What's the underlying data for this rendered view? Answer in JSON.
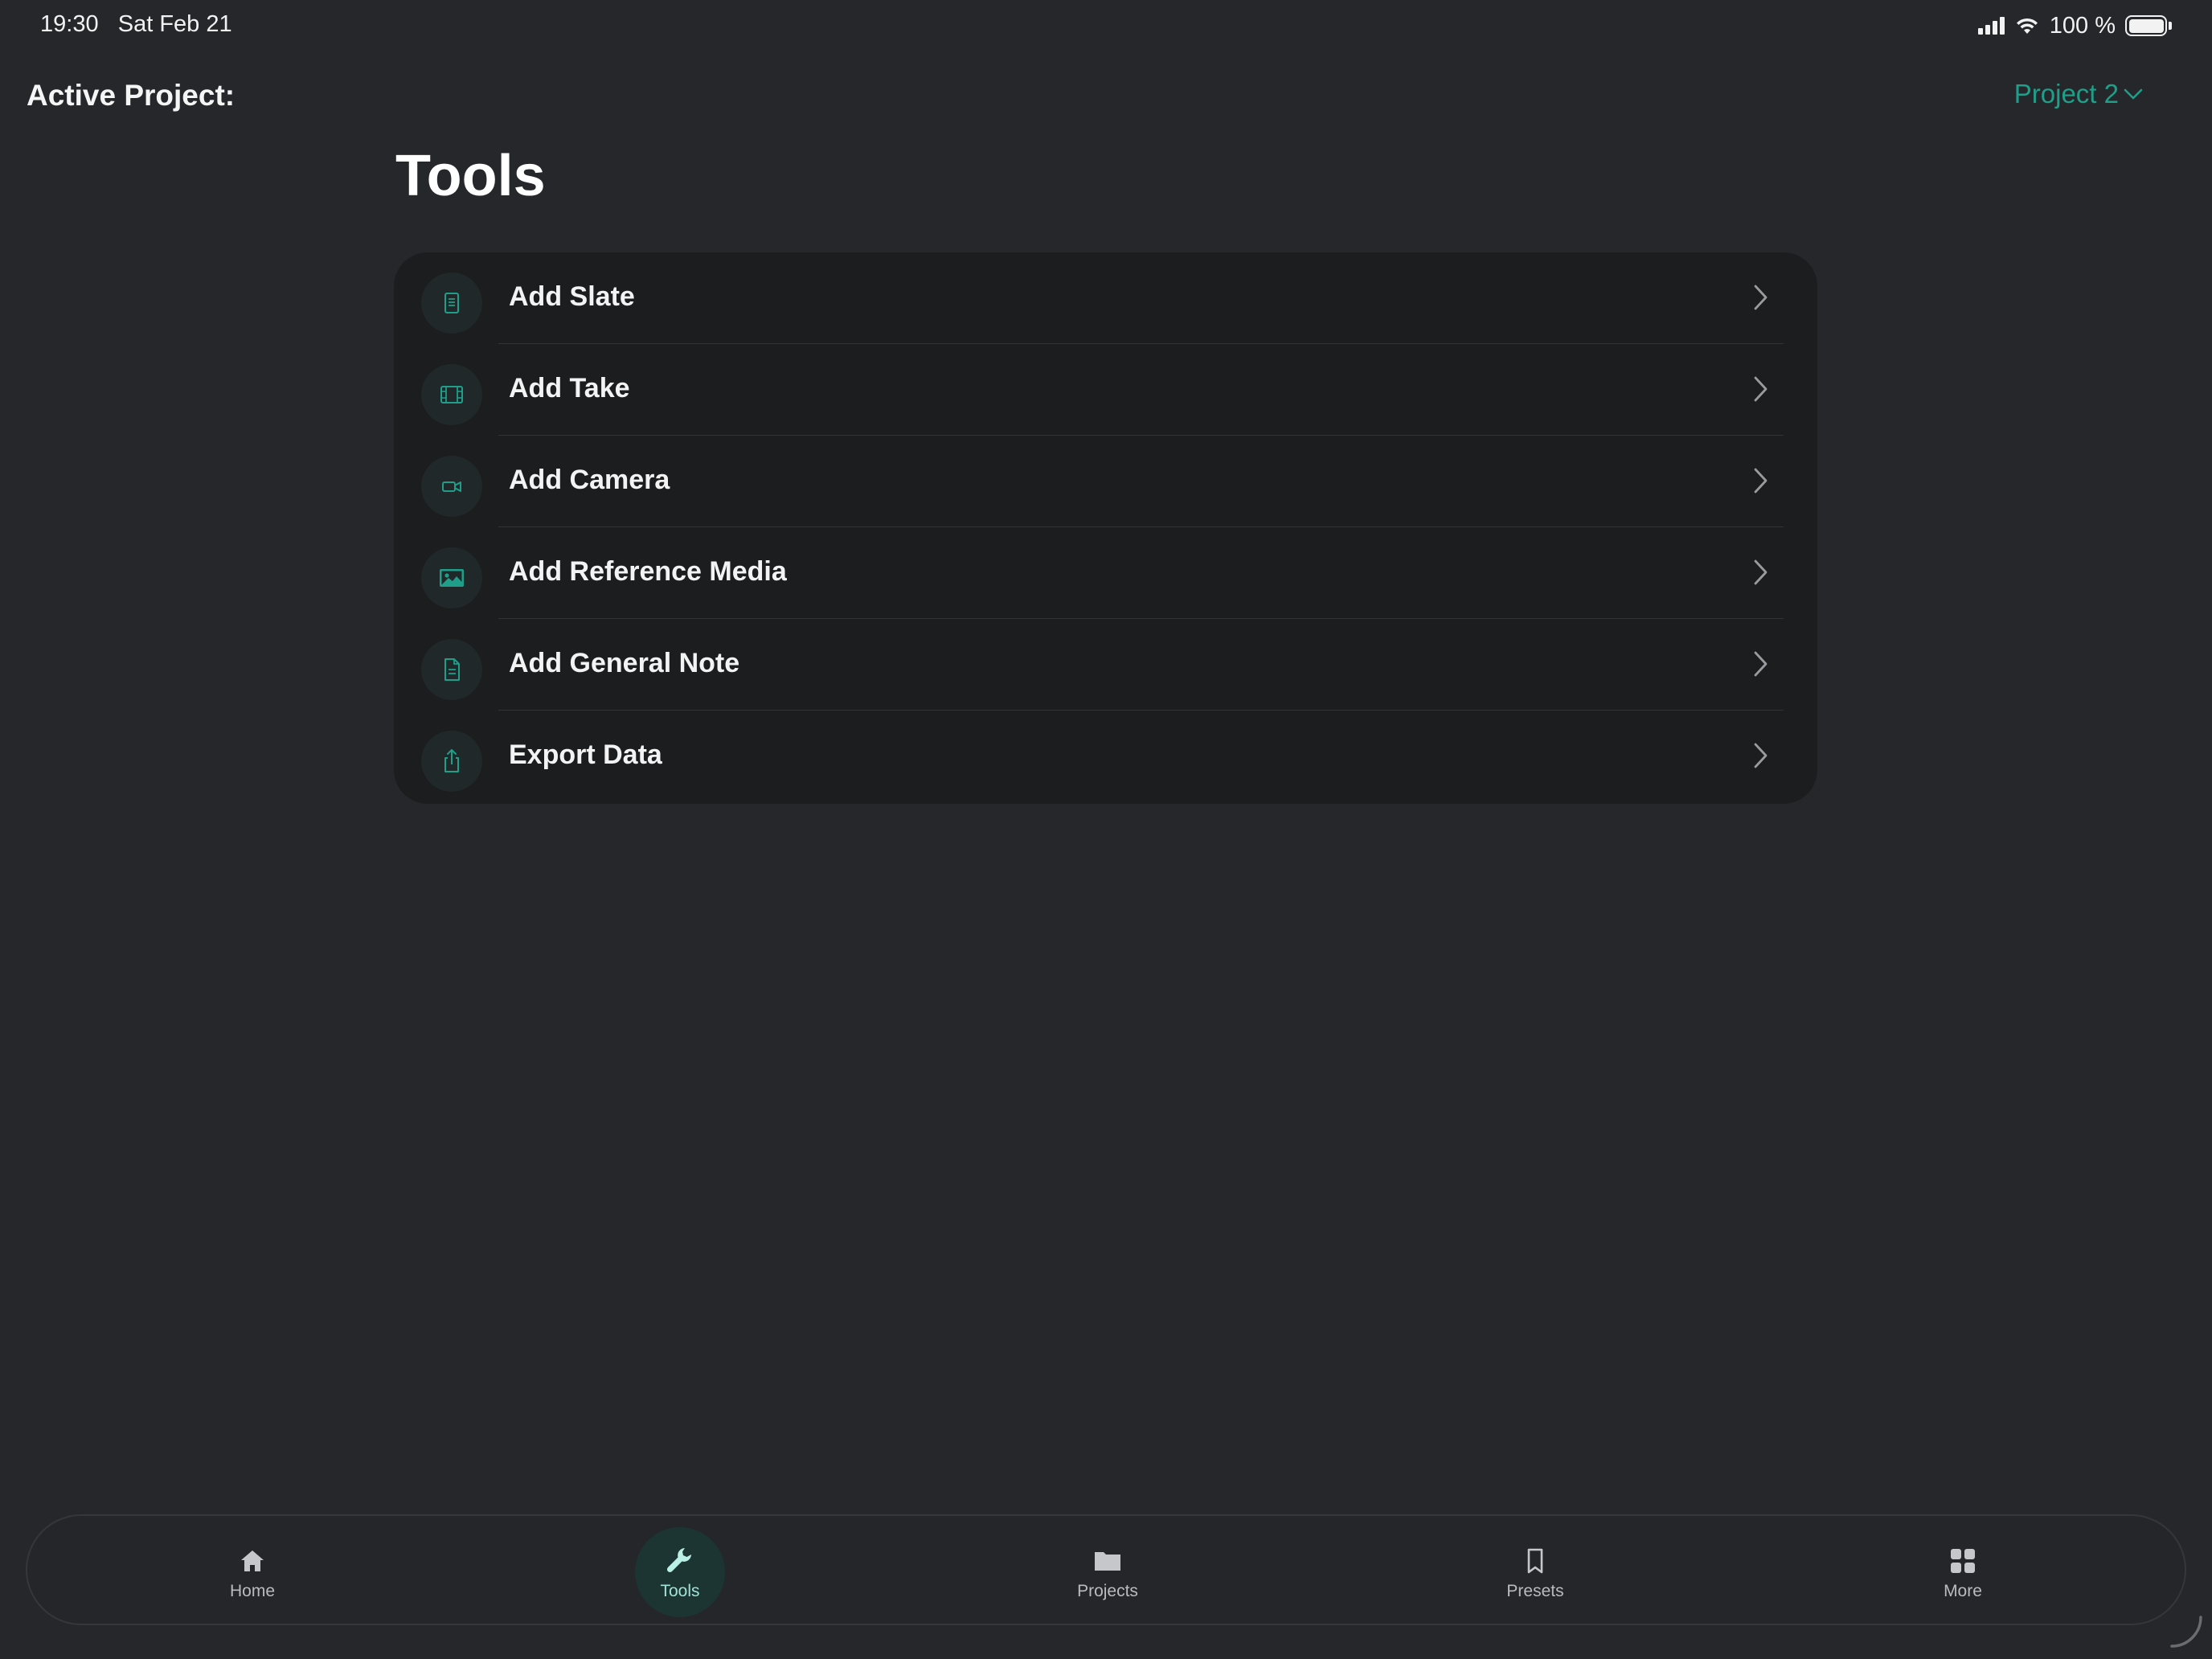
{
  "status_bar": {
    "time_date": "19:30   Sat Feb 21",
    "battery_text": "100 %"
  },
  "header": {
    "active_project_label": "Active Project:",
    "project_selector_value": "Project 2"
  },
  "page": {
    "title": "Tools"
  },
  "tools": [
    {
      "label": "Add Slate",
      "icon": "slate-icon"
    },
    {
      "label": "Add Take",
      "icon": "film-icon"
    },
    {
      "label": "Add Camera",
      "icon": "video-camera-icon"
    },
    {
      "label": "Add Reference Media",
      "icon": "image-icon"
    },
    {
      "label": "Add General Note",
      "icon": "document-icon"
    },
    {
      "label": "Export Data",
      "icon": "share-export-icon"
    }
  ],
  "tab_bar": {
    "tabs": [
      {
        "label": "Home",
        "icon": "house-icon",
        "active": false
      },
      {
        "label": "Tools",
        "icon": "wrench-icon",
        "active": true
      },
      {
        "label": "Projects",
        "icon": "folder-icon",
        "active": false
      },
      {
        "label": "Presets",
        "icon": "bookmark-icon",
        "active": false
      },
      {
        "label": "More",
        "icon": "grid-icon",
        "active": false
      }
    ]
  },
  "colors": {
    "background": "#26272a",
    "card": "#1c1d1f",
    "accent": "#1f9e8a",
    "active_tab_bg": "#1c3533"
  }
}
